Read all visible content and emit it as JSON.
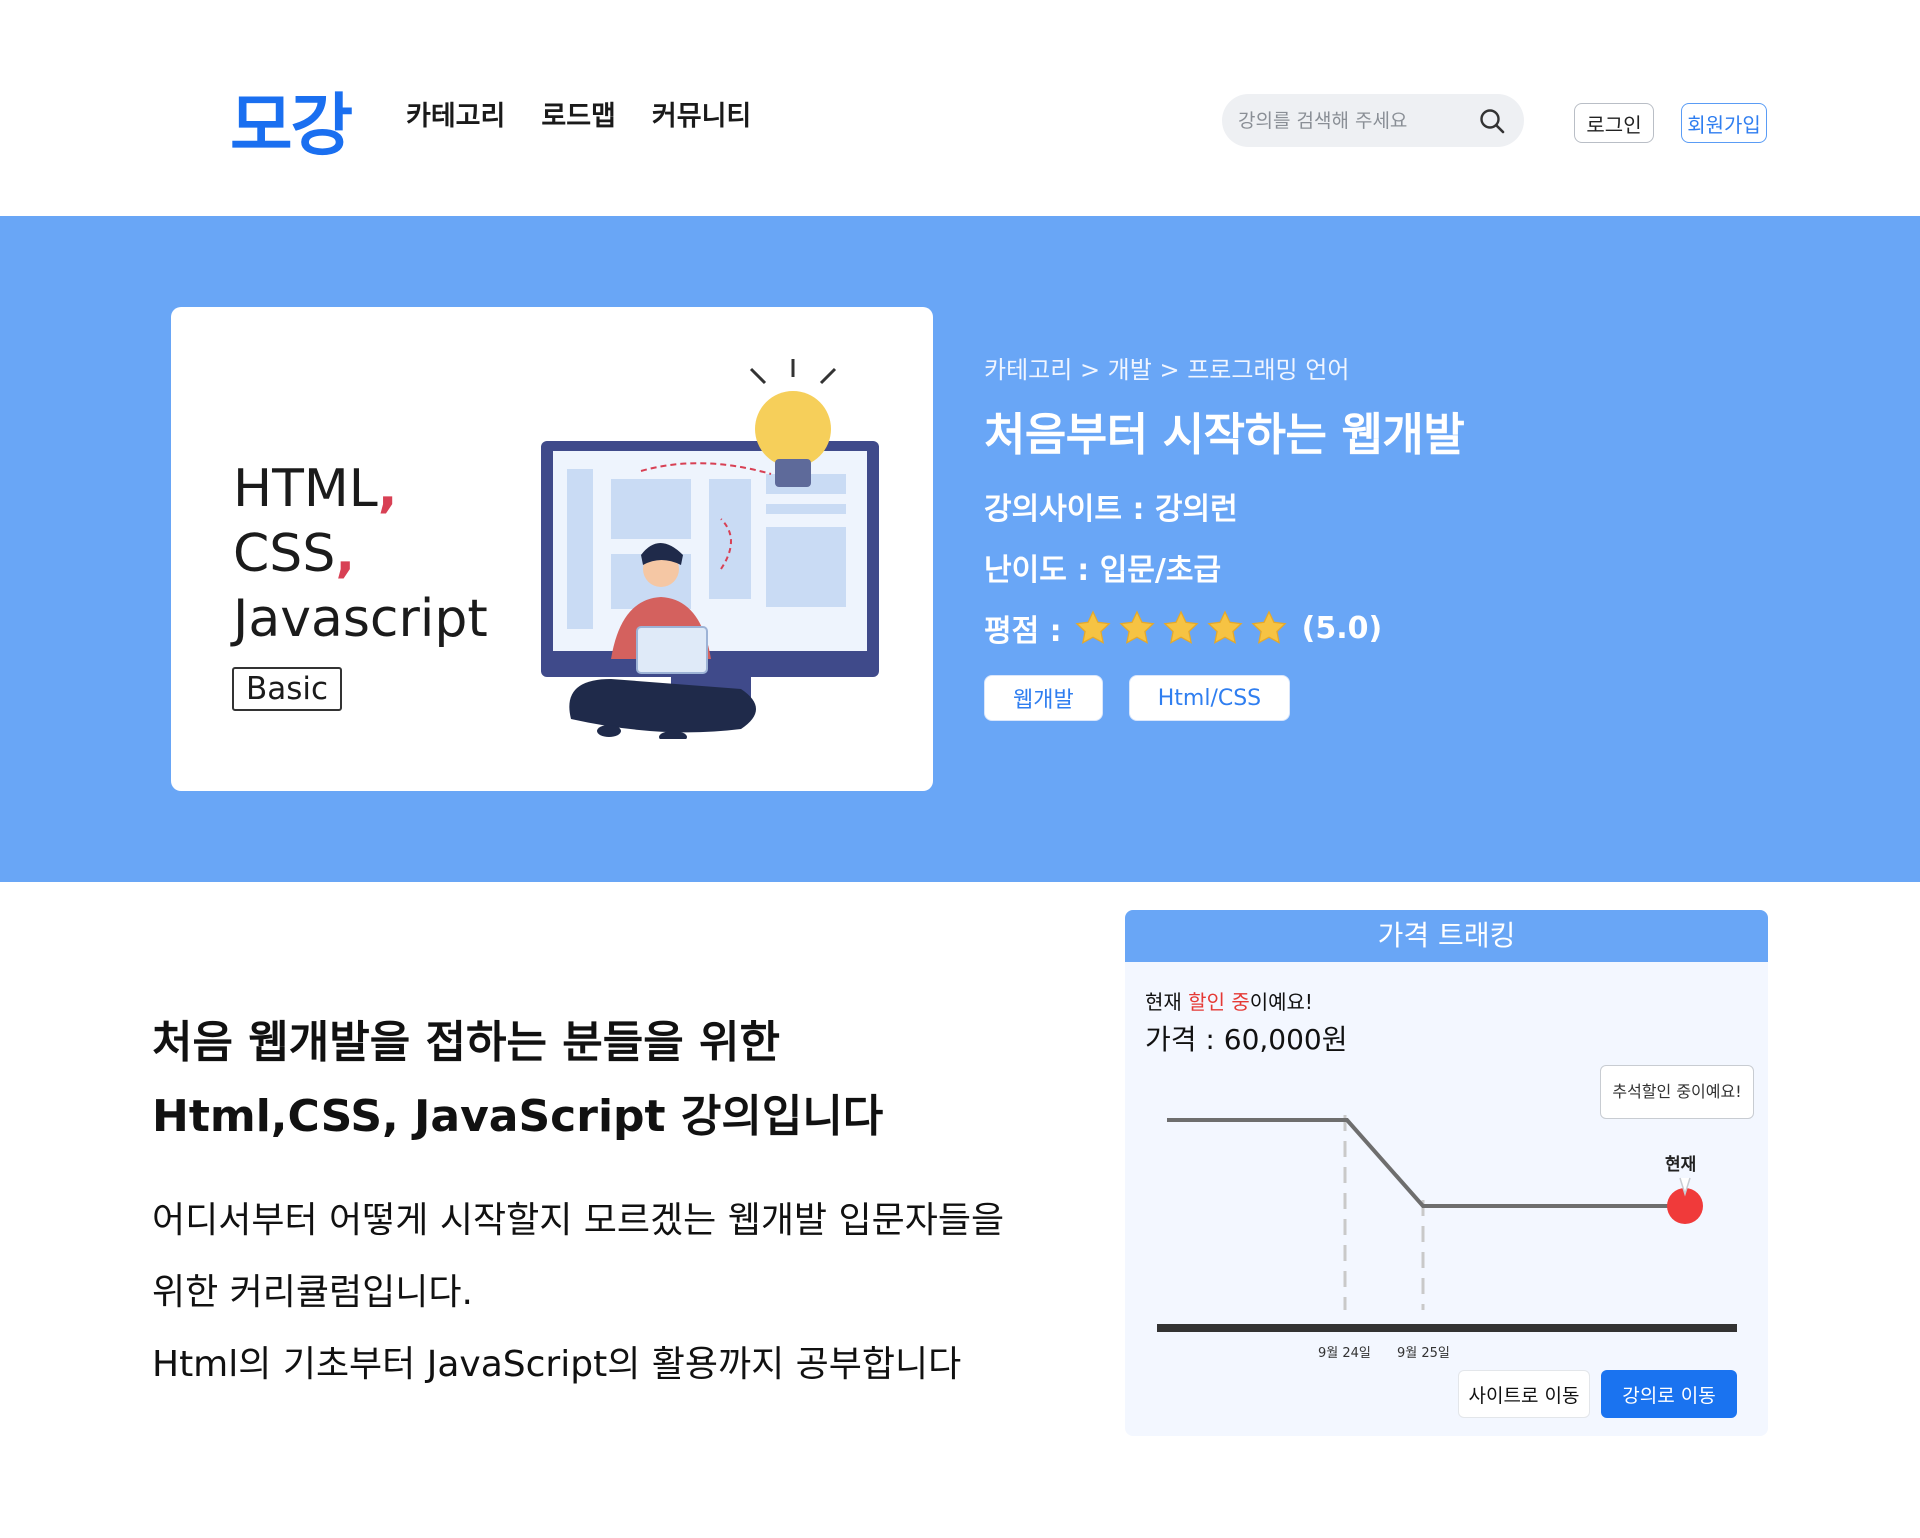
{
  "header": {
    "logo": "모강",
    "nav": [
      "카테고리",
      "로드맵",
      "커뮤니티"
    ],
    "search_placeholder": "강의를 검색해 주세요",
    "login_label": "로그인",
    "signup_label": "회원가입"
  },
  "hero": {
    "thumbnail": {
      "line1": "HTML",
      "line2": "CSS",
      "line3": "Javascript",
      "badge": "Basic"
    },
    "breadcrumb": "카테고리 > 개발 > 프로그래밍 언어",
    "title": "처음부터 시작하는 웹개발",
    "site_label": "강의사이트 : ",
    "site_value": "강의런",
    "level_label": "난이도 : ",
    "level_value": "입문/초급",
    "rating_label": "평점 : ",
    "rating_value": "(5.0)",
    "rating_stars": 5,
    "tags": [
      "웹개발",
      "Html/CSS"
    ]
  },
  "body": {
    "heading_line1": "처음 웹개발을 접하는 분들을 위한",
    "heading_line2": "Html,CSS, JavaScript 강의입니다",
    "desc_line1": "어디서부터 어떻게 시작할지 모르겠는 웹개발 입문자들을",
    "desc_line2": "위한 커리큘럼입니다.",
    "desc_line3": "Html의 기초부터 JavaScript의 활용까지 공부합니다"
  },
  "tracking": {
    "title": "가격 트래킹",
    "now_prefix": "현재 ",
    "now_highlight": "할인 중",
    "now_suffix": "이예요!",
    "price_text": "가격 : 60,000원",
    "tooltip": "추석할인 중이예요!",
    "now_marker": "현재",
    "date1": "9월 24일",
    "date2": "9월 25일",
    "btn_site": "사이트로 이동",
    "btn_course": "강의로 이동"
  },
  "colors": {
    "brand": "#1a6ff0",
    "hero_bg": "#69a6f6",
    "discount_red": "#e53935",
    "star": "#f6c343"
  }
}
